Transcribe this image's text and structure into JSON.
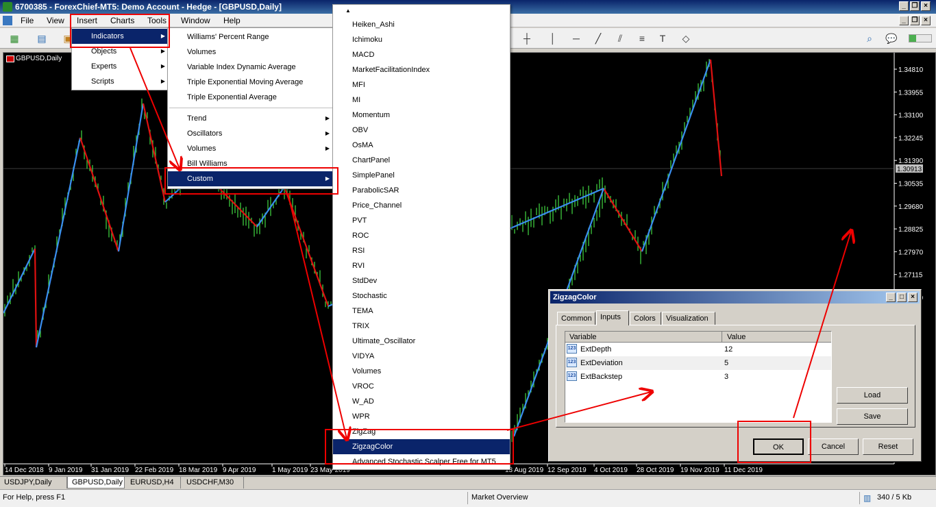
{
  "window": {
    "title": "6700385 - ForexChief-MT5: Demo Account - Hedge - [GBPUSD,Daily]"
  },
  "menubar": {
    "items": [
      "File",
      "View",
      "Insert",
      "Charts",
      "Tools",
      "Window",
      "Help"
    ]
  },
  "insert_menu": {
    "items": [
      "Indicators",
      "Objects",
      "Experts",
      "Scripts"
    ]
  },
  "indicators_menu": {
    "items": [
      "Williams' Percent Range",
      "Volumes",
      "Variable Index Dynamic Average",
      "Triple Exponential Moving Average",
      "Triple Exponential Average"
    ],
    "groups": [
      "Trend",
      "Oscillators",
      "Volumes",
      "Bill Williams",
      "Custom"
    ]
  },
  "custom_menu": {
    "items": [
      "Heiken_Ashi",
      "Ichimoku",
      "MACD",
      "MarketFacilitationIndex",
      "MFI",
      "MI",
      "Momentum",
      "OBV",
      "OsMA",
      "ChartPanel",
      "SimplePanel",
      "ParabolicSAR",
      "Price_Channel",
      "PVT",
      "ROC",
      "RSI",
      "RVI",
      "StdDev",
      "Stochastic",
      "TEMA",
      "TRIX",
      "Ultimate_Oscillator",
      "VIDYA",
      "Volumes",
      "VROC",
      "W_AD",
      "WPR",
      "ZigZag",
      "ZigzagColor",
      "Advanced Stochastic Scalper Free for MT5"
    ],
    "selected": "ZigzagColor"
  },
  "chart": {
    "title": "GBPUSD,Daily",
    "current_price": "1.30913",
    "price_labels": [
      "1.34810",
      "1.33955",
      "1.33100",
      "1.32245",
      "1.31390",
      "1.30535",
      "1.29680",
      "1.28825",
      "1.27970",
      "1.27115",
      "1.26260"
    ],
    "date_labels": [
      "14 Dec 2018",
      "9 Jan 2019",
      "31 Jan 2019",
      "22 Feb 2019",
      "18 Mar 2019",
      "9 Apr 2019",
      "1 May 2019",
      "23 May 2019",
      "13 Aug 2019",
      "12 Sep 2019",
      "4 Oct 2019",
      "28 Oct 2019",
      "19 Nov 2019",
      "11 Dec 2019"
    ],
    "colors": {
      "up_leg": "#3a8ef0",
      "down_leg": "#e01010",
      "candles": "#44dd44"
    }
  },
  "dialog": {
    "title": "ZigzagColor",
    "tabs": [
      "Common",
      "Inputs",
      "Colors",
      "Visualization"
    ],
    "active_tab": "Inputs",
    "columns": [
      "Variable",
      "Value"
    ],
    "params": [
      {
        "name": "ExtDepth",
        "value": "12",
        "icon": "123"
      },
      {
        "name": "ExtDeviation",
        "value": "5",
        "icon": "123"
      },
      {
        "name": "ExtBackstep",
        "value": "3",
        "icon": "123"
      }
    ],
    "buttons": {
      "load": "Load",
      "save": "Save",
      "ok": "OK",
      "cancel": "Cancel",
      "reset": "Reset"
    }
  },
  "tabs": [
    "USDJPY,Daily",
    "GBPUSD,Daily",
    "EURUSD,H4",
    "USDCHF,M30"
  ],
  "active_tab": "GBPUSD,Daily",
  "status": {
    "help": "For Help, press F1",
    "market": "Market Overview",
    "traffic": "340 / 5 Kb"
  }
}
